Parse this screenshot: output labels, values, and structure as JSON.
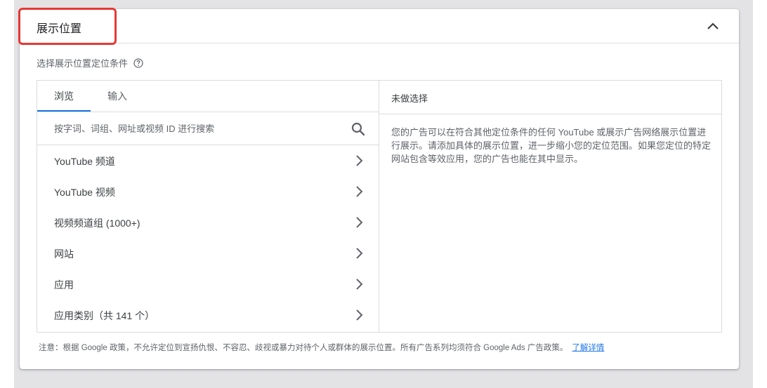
{
  "card": {
    "title": "展示位置",
    "subtitle": "选择展示位置定位条件",
    "collapse_icon": "chevron-up-icon",
    "help_icon": "help-circle-icon",
    "highlight_color": "#e53935"
  },
  "tabs": [
    {
      "label": "浏览",
      "active": true
    },
    {
      "label": "输入",
      "active": false
    }
  ],
  "search": {
    "placeholder": "按字词、词组、网址或视频 ID 进行搜索",
    "value": ""
  },
  "categories": [
    {
      "label": "YouTube 频道"
    },
    {
      "label": "YouTube 视频"
    },
    {
      "label": "视频频道组 (1000+)"
    },
    {
      "label": "网站"
    },
    {
      "label": "应用"
    },
    {
      "label": "应用类别（共 141 个）"
    }
  ],
  "selection": {
    "header": "未做选择",
    "description": "您的广告可以在符合其他定位条件的任何 YouTube 或展示广告网络展示位置进行展示。请添加具体的展示位置，进一步缩小您的定位范围。如果您定位的特定网站包含等效应用，您的广告也能在其中显示。"
  },
  "note": {
    "text": "注意：根据 Google 政策，不允许定位到宣扬仇恨、不容忍、歧视或暴力对待个人或群体的展示位置。所有广告系列均须符合 Google Ads 广告政策。",
    "link": "了解详情"
  },
  "colors": {
    "accent": "#1a73e8",
    "text": "#3c4043",
    "muted": "#5f6368",
    "border": "#dadce0"
  }
}
